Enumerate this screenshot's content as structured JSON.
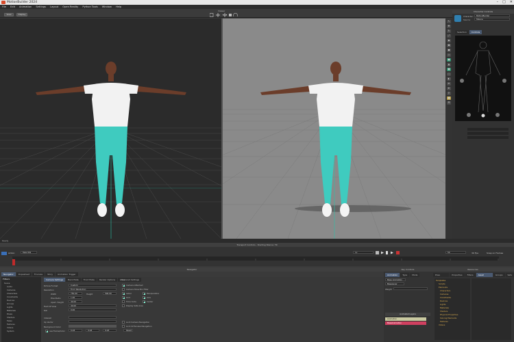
{
  "window": {
    "title": "MotionBuilder 2024"
  },
  "menu": [
    "File",
    "Edit",
    "Animation",
    "Settings",
    "Layout",
    "Open Reality",
    "Python Tools",
    "Window",
    "Help"
  ],
  "toolbar": {
    "btn_a": "View",
    "btn_b": "Display",
    "center_label": "Viewer"
  },
  "character_controls": {
    "title": "Character Controls",
    "character_label": "Character:",
    "character_value": "MotionBuilder",
    "source_label": "Source:",
    "source_value": "Stance",
    "tab_selection": "Selection",
    "tab_controls": "Controls"
  },
  "status": {
    "text": "Ready"
  },
  "transport": {
    "title": "Transport Controls - Starting Stance: TR",
    "take": "Take 001",
    "speed_label": "1x",
    "end_value": "50",
    "fps": "30 Fps",
    "snap": "Snap on Frames"
  },
  "navigator": {
    "title": "Navigator",
    "tabs": [
      "Navigator",
      "Dopesheet",
      "FCurves",
      "Story",
      "Animation Trigger"
    ],
    "tree_header": "Filters",
    "tree": [
      "Scene",
      "Audio",
      "Cameras",
      "Characters",
      "Constraints",
      "Devices",
      "Groups",
      "Lights",
      "Materials",
      "Poses",
      "Shaders",
      "Takes",
      "Textures",
      "Videos",
      "System"
    ]
  },
  "camera_settings": {
    "tabs": [
      "Camera Settings",
      "Back Plate",
      "Front Plate",
      "Render Options",
      "Advanced Settings"
    ],
    "picture_format_label": "Picture Format",
    "picture_format_value": "Custom",
    "resolution_label": "Resolution",
    "resolution_value": "From Resolution",
    "width_label": "Width",
    "width_value": "750.00",
    "height_label": "Height",
    "height_value": "500.00",
    "pixel_ratio_label": "Pixel Ratio",
    "pixel_ratio_value": "1.00",
    "aperture_label": "Apert. Height",
    "aperture_value": "40.00",
    "fov_label": "Field Of View",
    "fov_value": "40.00",
    "roll_label": "Roll",
    "roll_value": "0.00",
    "interest_label": "Interest",
    "up_vector_label": "Up Vector",
    "bg_color_label": "Background Color",
    "use_frame_label": "use Frame/Color",
    "bg_r": "0.28",
    "bg_g": "0.28",
    "bg_b": "0.28",
    "view_header": "View",
    "checks": [
      {
        "label": "Camera Attached",
        "on": true
      },
      {
        "label": "Camera Show Bin Filter",
        "on": false
      },
      {
        "label": "Label",
        "on": true
      },
      {
        "label": "Manipulators",
        "on": true
      },
      {
        "label": "Grid",
        "on": true
      },
      {
        "label": "Axis",
        "on": true
      },
      {
        "label": "Time Code",
        "on": false
      },
      {
        "label": "Center",
        "on": true
      },
      {
        "label": "Display Safe Area",
        "on": false
      }
    ],
    "lock_cam": "Lock Camera Navigation",
    "lock_ortho": "Lock Orthoview Navigation",
    "reset": "Reset"
  },
  "key_controls": {
    "title": "Key Controls",
    "tabs": [
      "Animation",
      "Type",
      "Mode"
    ],
    "base_anim": "Base Animation",
    "layer": "BaseLayer",
    "animated_layers": "Animated Layers",
    "layer_items": [
      "Animation",
      "BaseAnimation"
    ],
    "weight": "Weight"
  },
  "resources": {
    "title": "Resources",
    "tabs": [
      "Pose Controls",
      "Properties",
      "Filters",
      "Asset Browser",
      "Groups",
      "Sets"
    ],
    "tree": [
      "Templates",
      "Scripts",
      "Elements",
      "Characters",
      "Cameras",
      "Constraints",
      "Devices",
      "Lights",
      "Materials",
      "Shaders",
      "Physical Properties",
      "Solving Elements",
      "Textures",
      "Videos"
    ]
  },
  "colors": {
    "viewport_left": "#2b2b2b",
    "viewport_right": "#8a8a8a",
    "shirt": "#f2f2f2",
    "pants": "#3fcbbf",
    "skin": "#6b3d2a",
    "grid_axis": "#29c4a8",
    "accent": "#4a5a72"
  }
}
